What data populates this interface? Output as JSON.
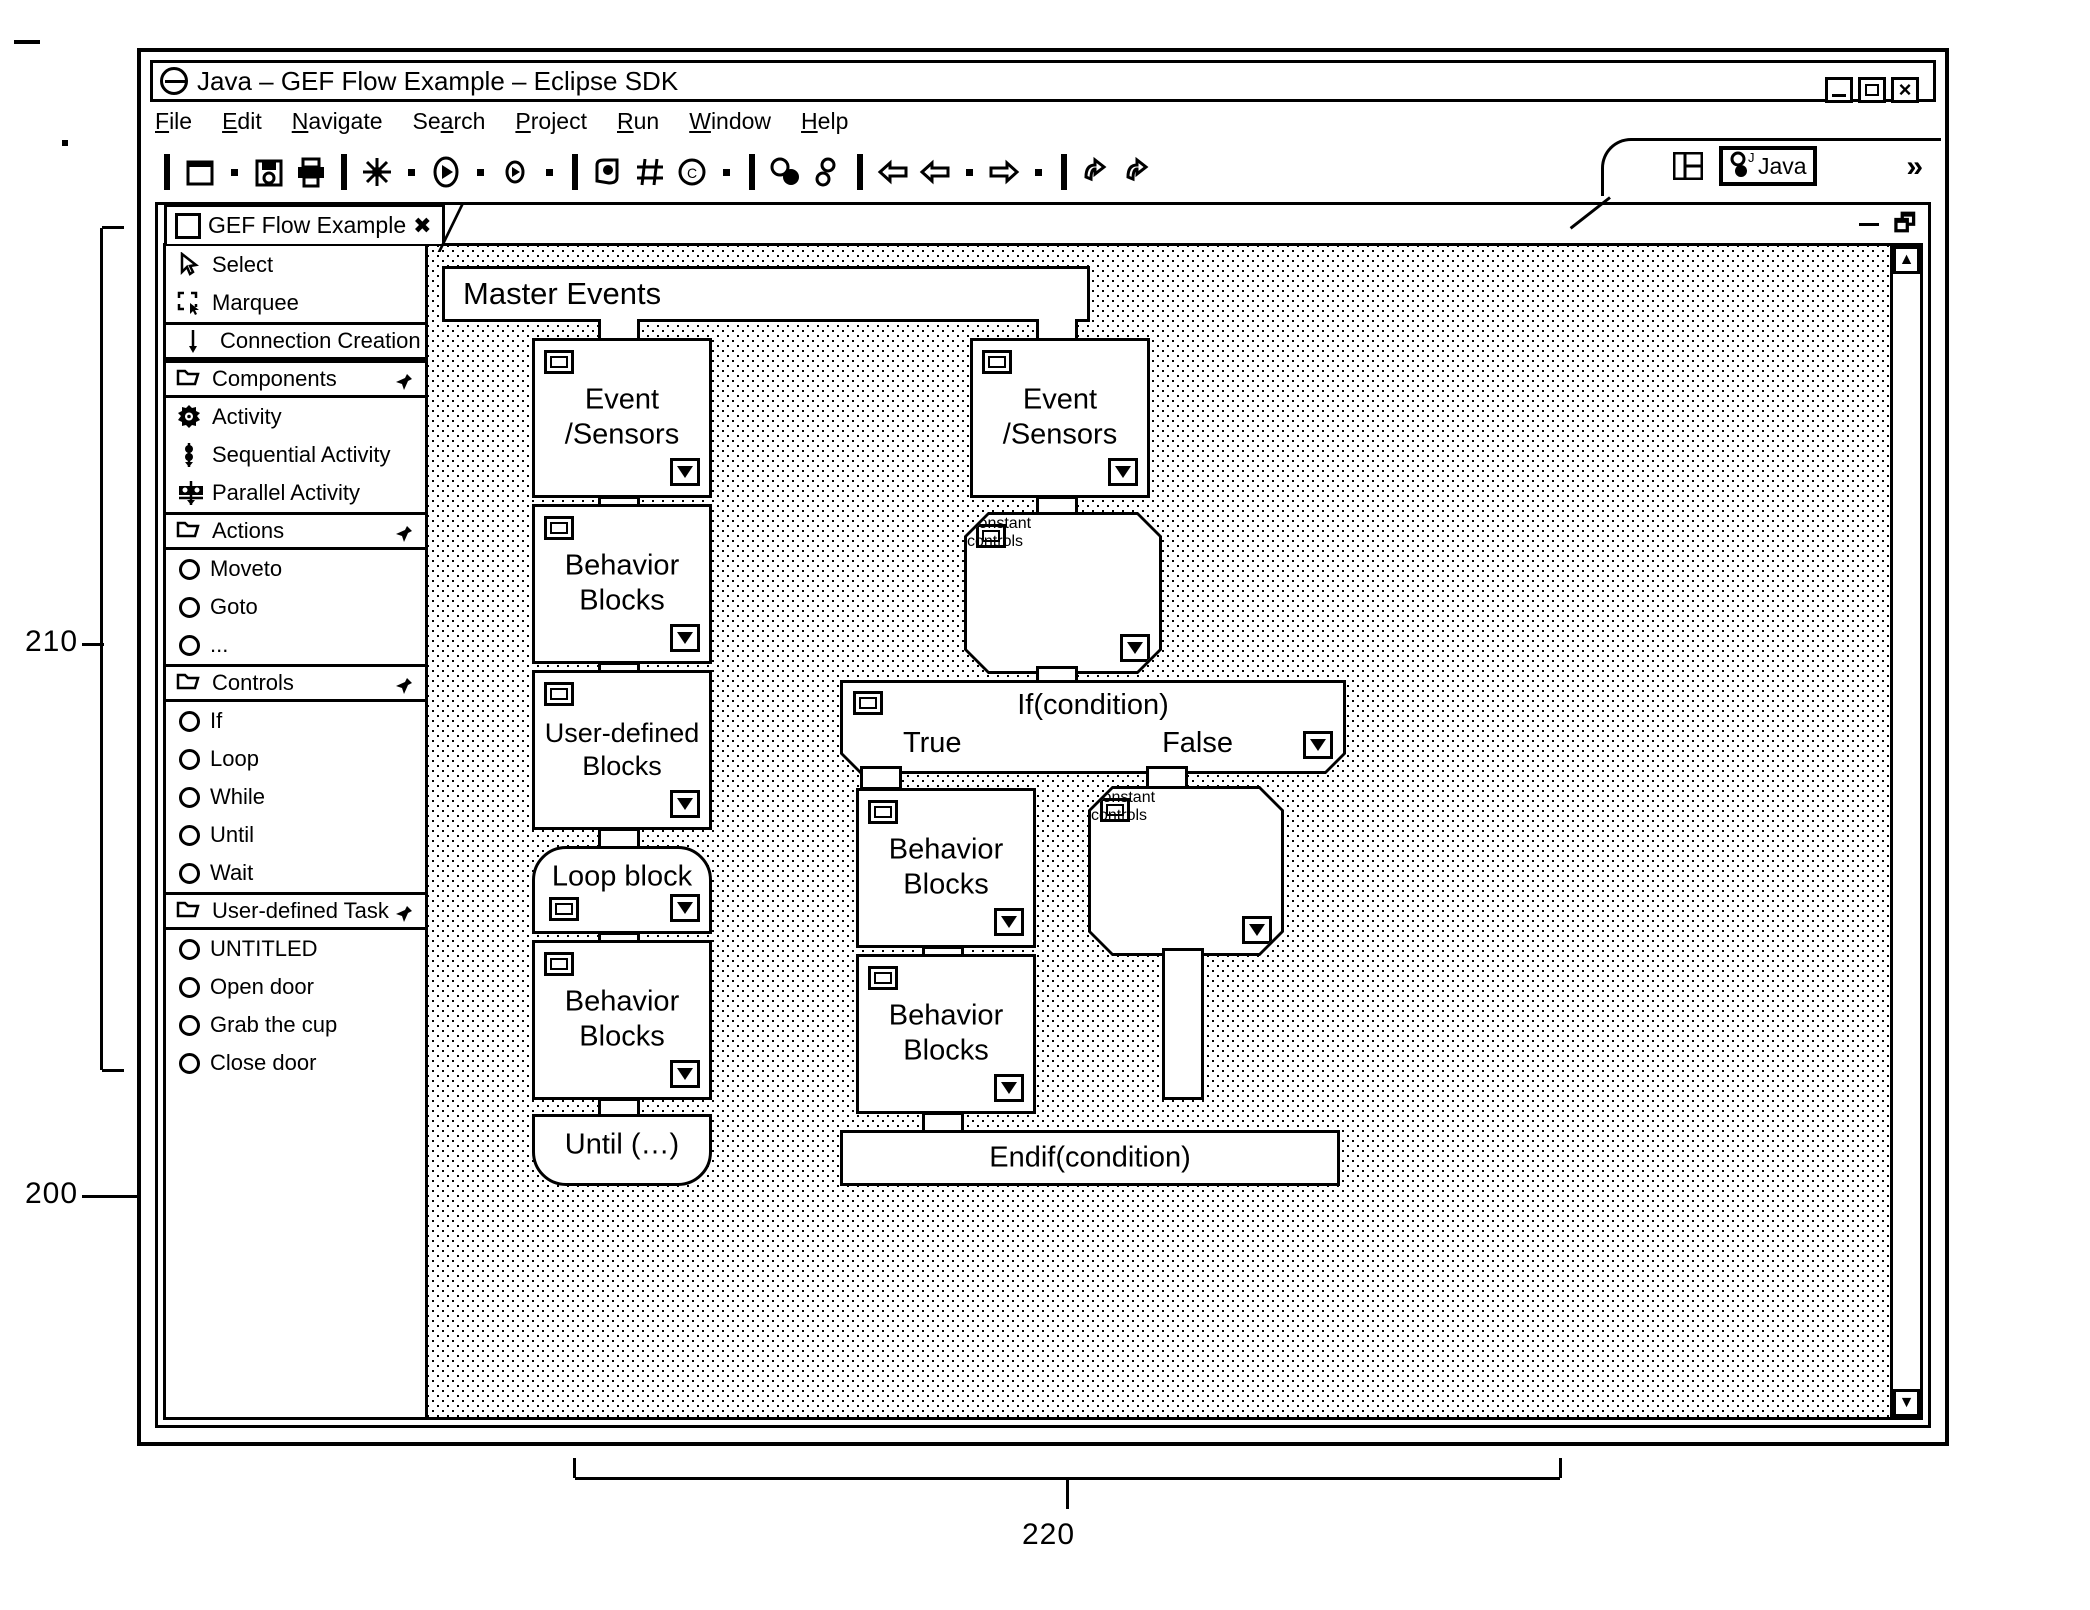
{
  "window": {
    "title": "Java – GEF Flow Example – Eclipse SDK",
    "controls": {
      "minimize": "_",
      "maximize": "□",
      "close": "×"
    }
  },
  "menubar": [
    {
      "label": "File",
      "mnemonic": "F"
    },
    {
      "label": "Edit",
      "mnemonic": "E"
    },
    {
      "label": "Navigate",
      "mnemonic": "N"
    },
    {
      "label": "Search",
      "mnemonic": "a"
    },
    {
      "label": "Project",
      "mnemonic": "P"
    },
    {
      "label": "Run",
      "mnemonic": "R"
    },
    {
      "label": "Window",
      "mnemonic": "W"
    },
    {
      "label": "Help",
      "mnemonic": "H"
    }
  ],
  "toolbar": {
    "icons": [
      "new-file-icon",
      "dropdown-arrow-icon",
      "save-icon",
      "print-icon",
      "build-icon",
      "dropdown-arrow-icon",
      "run-icon",
      "dropdown-arrow-icon",
      "debug-icon",
      "dropdown-arrow-icon",
      "search-icon",
      "grid-icon",
      "copyright-icon",
      "dropdown-arrow-icon",
      "open-type-icon",
      "link-icon",
      "back-icon",
      "prev-icon",
      "dropdown-arrow-icon",
      "next-icon",
      "dropdown-arrow-icon",
      "undo-icon",
      "redo-icon"
    ],
    "perspective": {
      "layout_icon": "perspective-grid-icon",
      "active_label": "Java",
      "active_icon": "java-perspective-icon",
      "overflow": "»"
    }
  },
  "editor": {
    "tab": {
      "label": "GEF Flow Example",
      "close": "✖",
      "icon": "editor-file-icon"
    },
    "minimize": "minimize-icon",
    "maximize": "maximize-icon",
    "scrollbar": {
      "up": "▲",
      "down": "▼"
    }
  },
  "palette": {
    "tools": [
      {
        "label": "Select",
        "icon": "cursor-arrow-icon"
      },
      {
        "label": "Marquee",
        "icon": "marquee-select-icon"
      }
    ],
    "connection": {
      "label": "Connection Creation",
      "icon": "connection-creation-icon"
    },
    "groups": [
      {
        "label": "Components",
        "icon": "folder-icon",
        "pin": "pin-icon",
        "items": [
          {
            "label": "Activity",
            "icon": "activity-gear-icon"
          },
          {
            "label": "Sequential Activity",
            "icon": "sequential-activity-icon"
          },
          {
            "label": "Parallel Activity",
            "icon": "parallel-activity-icon"
          }
        ]
      },
      {
        "label": "Actions",
        "icon": "folder-icon",
        "pin": "pin-icon",
        "items": [
          {
            "label": "Moveto",
            "icon": "circle-icon"
          },
          {
            "label": "Goto",
            "icon": "circle-icon"
          },
          {
            "label": "...",
            "icon": "circle-icon"
          }
        ]
      },
      {
        "label": "Controls",
        "icon": "folder-icon",
        "pin": "pin-icon",
        "items": [
          {
            "label": "If",
            "icon": "circle-icon"
          },
          {
            "label": "Loop",
            "icon": "circle-icon"
          },
          {
            "label": "While",
            "icon": "circle-icon"
          },
          {
            "label": "Until",
            "icon": "circle-icon"
          },
          {
            "label": "Wait",
            "icon": "circle-icon"
          }
        ]
      },
      {
        "label": "User-defined Task",
        "icon": "folder-icon",
        "pin": "pin-icon",
        "items": [
          {
            "label": "UNTITLED",
            "icon": "circle-icon"
          },
          {
            "label": "Open door",
            "icon": "circle-icon"
          },
          {
            "label": "Grab the cup",
            "icon": "circle-icon"
          },
          {
            "label": "Close door",
            "icon": "circle-icon"
          }
        ]
      }
    ]
  },
  "diagram": {
    "nodes": [
      {
        "id": "master",
        "label": "Master Events"
      },
      {
        "id": "evs-left",
        "label": "Event\n/Sensors"
      },
      {
        "id": "evs-right",
        "label": "Event\n/Sensors"
      },
      {
        "id": "beh-1",
        "label": "Behavior\nBlocks"
      },
      {
        "id": "const-1",
        "label": "Constant\ncontrols"
      },
      {
        "id": "user-1",
        "label": "User-defined\nBlocks"
      },
      {
        "id": "ifcond",
        "label": "If(condition)",
        "true_label": "True",
        "false_label": "False"
      },
      {
        "id": "loop",
        "label": "Loop block"
      },
      {
        "id": "beh-2",
        "label": "Behavior\nBlocks"
      },
      {
        "id": "const-2",
        "label": "Constant\ncontrols"
      },
      {
        "id": "beh-3",
        "label": "Behavior\nBlocks"
      },
      {
        "id": "beh-4",
        "label": "Behavior\nBlocks"
      },
      {
        "id": "until",
        "label": "Until (…)"
      },
      {
        "id": "endif",
        "label": "Endif(condition)"
      }
    ]
  },
  "figure_callouts": [
    {
      "ref": "210",
      "target": "palette"
    },
    {
      "ref": "200",
      "target": "workbench-window"
    },
    {
      "ref": "220",
      "target": "diagram-canvas"
    }
  ]
}
